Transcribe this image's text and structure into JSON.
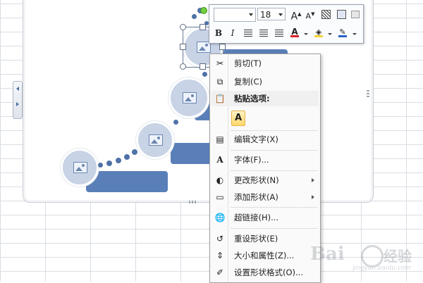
{
  "mini_toolbar": {
    "font_name": "",
    "font_size": "18",
    "grow_font_label": "A",
    "shrink_font_label": "A",
    "bold_label": "B",
    "italic_label": "I",
    "font_color_label": "A"
  },
  "context_menu": {
    "items": [
      {
        "label": "剪切(T)",
        "icon": "scissors-icon"
      },
      {
        "label": "复制(C)",
        "icon": "copy-icon"
      },
      {
        "label": "粘贴选项:",
        "icon": "paste-icon"
      },
      {
        "label": "编辑文字(X)",
        "icon": "edit-text-icon"
      },
      {
        "label": "字体(F)...",
        "icon": "font-icon"
      },
      {
        "label": "更改形状(N)",
        "icon": "change-shape-icon"
      },
      {
        "label": "添加形状(A)",
        "icon": "add-shape-icon"
      },
      {
        "label": "超链接(H)...",
        "icon": "hyperlink-icon"
      },
      {
        "label": "重设形状(E)",
        "icon": "reset-shape-icon"
      },
      {
        "label": "大小和属性(Z)...",
        "icon": "size-properties-icon"
      },
      {
        "label": "设置形状格式(O)...",
        "icon": "format-shape-icon"
      }
    ],
    "paste_option_label": "A"
  },
  "watermark": {
    "logo": "Bai",
    "text": "经验",
    "url": "jingyan.baidu.com"
  },
  "colors": {
    "shape_fill": "#c8d3e6",
    "bar_fill": "#5a7fb8",
    "dot_fill": "#4f72a8",
    "font_color": "#d8262b",
    "highlight_color": "#f3d33a"
  }
}
